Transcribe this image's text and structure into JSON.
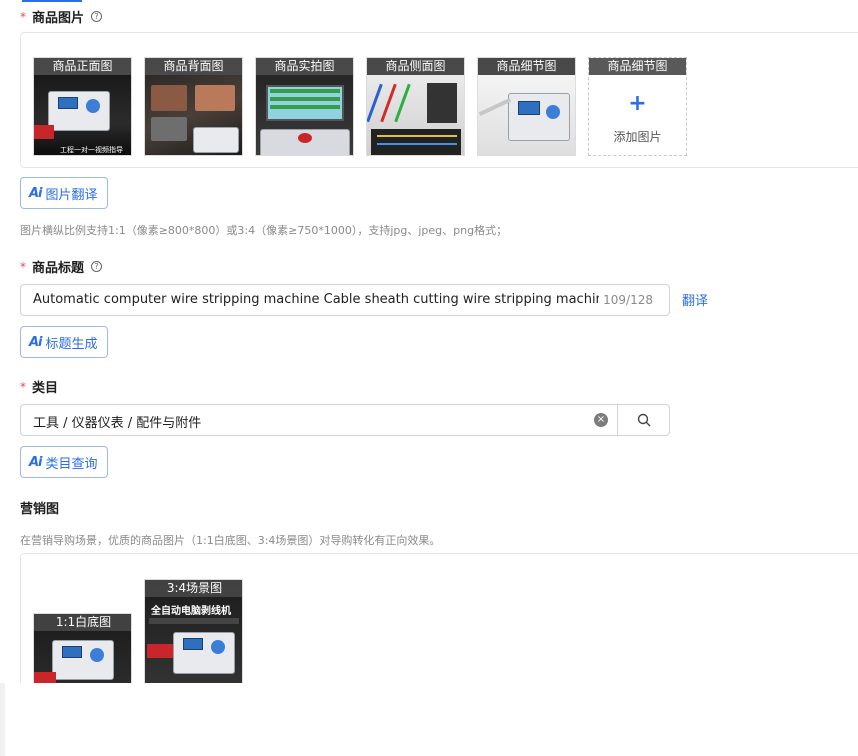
{
  "product_images": {
    "label": "商品图片",
    "required_mark": "*",
    "help": "?",
    "slots": [
      {
        "caption": "商品正面图",
        "overlay_text": "工程一对一视频指导"
      },
      {
        "caption": "商品背面图"
      },
      {
        "caption": "商品实拍图"
      },
      {
        "caption": "商品侧面图"
      },
      {
        "caption": "商品细节图"
      }
    ],
    "add_slot": {
      "caption": "商品细节图",
      "plus": "+",
      "label": "添加图片"
    },
    "ai_button": {
      "icon": "Ai",
      "label": "图片翻译"
    },
    "hint": "图片横纵比例支持1:1（像素≥800*800）或3:4（像素≥750*1000），支持jpg、jpeg、png格式；"
  },
  "product_title": {
    "label": "商品标题",
    "required_mark": "*",
    "help": "?",
    "value": "Automatic computer wire stripping machine Cable sheath cutting wire stripping machine BV",
    "count": "109/128",
    "translate": "翻译",
    "ai_button": {
      "icon": "Ai",
      "label": "标题生成"
    }
  },
  "category": {
    "label": "类目",
    "required_mark": "*",
    "value": "工具 / 仪器仪表 / 配件与附件",
    "clear": "×",
    "ai_button": {
      "icon": "Ai",
      "label": "类目查询"
    }
  },
  "marketing": {
    "label": "营销图",
    "hint": "在营销导购场景，优质的商品图片（1:1白底图、3:4场景图）对导购转化有正向效果。",
    "items": [
      {
        "caption": "1:1白底图"
      },
      {
        "caption": "3:4场景图",
        "overlay_text": "全自动电脑剥线机"
      }
    ]
  },
  "colors": {
    "accent": "#2a6ee8",
    "required": "#e34d59"
  }
}
